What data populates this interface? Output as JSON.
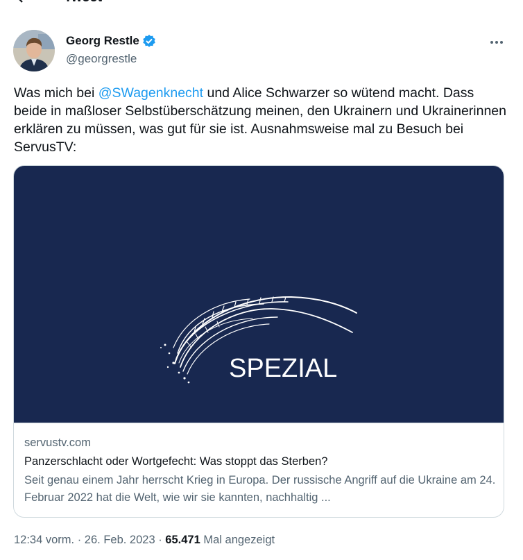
{
  "header": {
    "title": "Tweet",
    "back_icon": "back-arrow-icon"
  },
  "author": {
    "display_name": "Georg Restle",
    "handle": "@georgrestle",
    "verified_icon": "verified-badge-icon",
    "verified_color": "#1d9bf0"
  },
  "more_icon": "more-horizontal-icon",
  "tweet": {
    "text_before_mention": "Was mich bei ",
    "mention": "@SWagenknecht",
    "text_after_mention": " und Alice Schwarzer so wütend macht. Dass beide in maßloser Selbstüberschätzung meinen, den Ukrainern und Ukrainerinnen erklären zu müssen, was gut für sie ist. Ausnahmsweise mal zu Besuch bei ServusTV:"
  },
  "card": {
    "image_text": "SPEZIAL",
    "image_background": "#182850",
    "domain": "servustv.com",
    "title": "Panzerschlacht oder Wortgefecht: Was stoppt das Sterben?",
    "description": "Seit genau einem Jahr herrscht Krieg in Europa. Der russische Angriff auf die Ukraine am 24. Februar 2022 hat die Welt, wie wir sie kannten, nachhaltig ..."
  },
  "meta": {
    "time": "12:34 vorm.",
    "separator": " · ",
    "date": "26. Feb. 2023",
    "views_count": "65.471",
    "views_label": " Mal angezeigt"
  },
  "colors": {
    "text_primary": "#0f1419",
    "text_secondary": "#536471",
    "link": "#1d9bf0",
    "border": "#cfd9de"
  }
}
